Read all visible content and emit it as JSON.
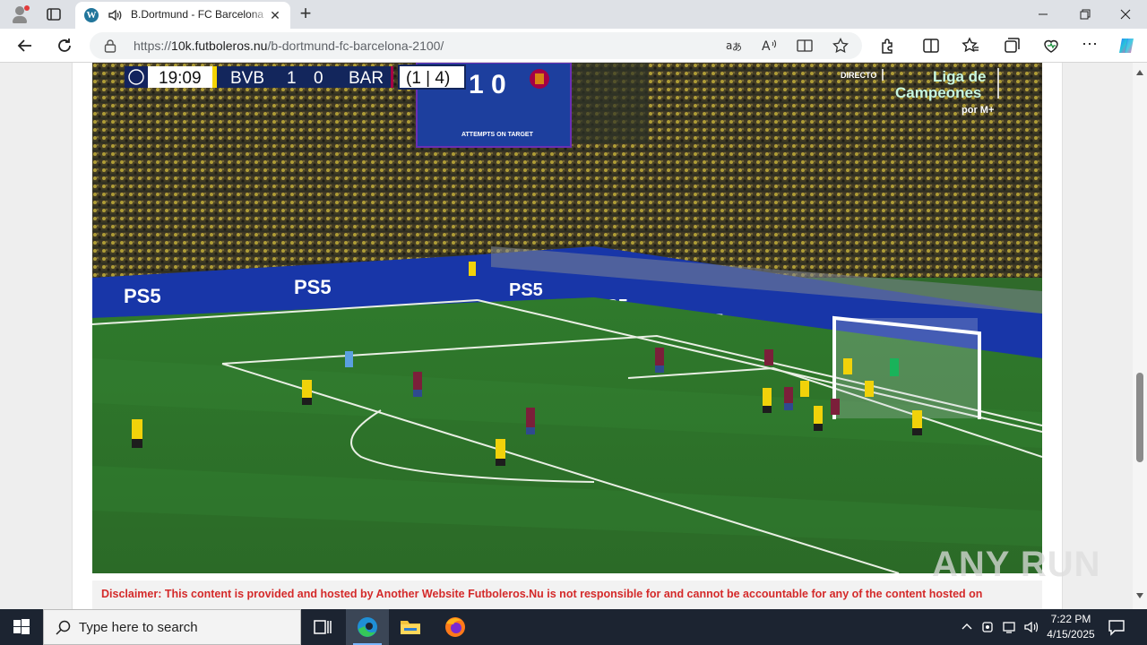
{
  "browser": {
    "tab": {
      "title": "B.Dortmund - FC Barcelona",
      "favicon_icon": "wordpress-icon",
      "audio_icon": "speaker-icon"
    },
    "url_prefix": "https://",
    "url_host": "10k.futboleros.nu",
    "url_path": "/b-dortmund-fc-barcelona-2100/"
  },
  "video": {
    "clock": "19:09",
    "home_team": "BVB",
    "home_score": "1",
    "away_score": "0",
    "away_team": "BAR",
    "aggregate": "(1 | 4)",
    "big_board_score": "1  0",
    "big_board_caption": "ATTEMPTS ON TARGET",
    "broadcast_live": "DIRECTO",
    "broadcast_title_1": "Liga de",
    "broadcast_title_2": "Campeones",
    "broadcast_channel": "por M+",
    "ad_board": "PS5"
  },
  "page": {
    "disclaimer": "Disclaimer: This content is provided and hosted by Another Website Futboleros.Nu is not responsible for and cannot be accountable for any of the content hosted on"
  },
  "watermark": "ANY RUN",
  "taskbar": {
    "search_placeholder": "Type here to search",
    "time": "7:22 PM",
    "date": "4/15/2025"
  },
  "colors": {
    "pitch": "#2f6a2a",
    "scoreboard_navy": "#13265c",
    "disclaimer_red": "#d42a2a",
    "taskbar": "#1c2431"
  }
}
